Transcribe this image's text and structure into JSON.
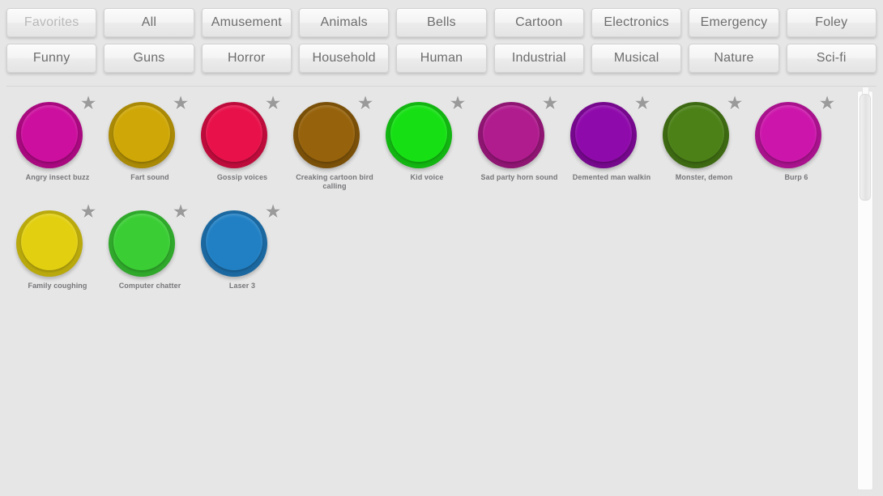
{
  "tabs": {
    "row1": [
      {
        "label": "Favorites",
        "disabled": true
      },
      {
        "label": "All",
        "disabled": false
      },
      {
        "label": "Amusement",
        "disabled": false
      },
      {
        "label": "Animals",
        "disabled": false
      },
      {
        "label": "Bells",
        "disabled": false
      },
      {
        "label": "Cartoon",
        "disabled": false
      },
      {
        "label": "Electronics",
        "disabled": false
      },
      {
        "label": "Emergency",
        "disabled": false
      },
      {
        "label": "Foley",
        "disabled": false
      }
    ],
    "row2": [
      {
        "label": "Funny",
        "disabled": false
      },
      {
        "label": "Guns",
        "disabled": false
      },
      {
        "label": "Horror",
        "disabled": false
      },
      {
        "label": "Household",
        "disabled": false
      },
      {
        "label": "Human",
        "disabled": false
      },
      {
        "label": "Industrial",
        "disabled": false
      },
      {
        "label": "Musical",
        "disabled": false
      },
      {
        "label": "Nature",
        "disabled": false
      },
      {
        "label": "Sci-fi",
        "disabled": false
      }
    ]
  },
  "pads": [
    {
      "label": "Angry insect buzz",
      "color": "#cc0f9e",
      "rim": "#a8097f",
      "favorite_icon": "star-icon"
    },
    {
      "label": "Fart sound",
      "color": "#cfa706",
      "rim": "#a98905",
      "favorite_icon": "star-icon"
    },
    {
      "label": "Gossip voices",
      "color": "#e8114a",
      "rim": "#bd0c3c",
      "favorite_icon": "star-icon"
    },
    {
      "label": "Creaking cartoon bird calling",
      "color": "#96620b",
      "rim": "#7a5009",
      "favorite_icon": "star-icon"
    },
    {
      "label": "Kid voice",
      "color": "#16e014",
      "rim": "#12b511",
      "favorite_icon": "star-icon"
    },
    {
      "label": "Sad party horn sound",
      "color": "#b01b8e",
      "rim": "#8f1573",
      "favorite_icon": "star-icon"
    },
    {
      "label": "Demented man walkin",
      "color": "#8f0aab",
      "rim": "#75088c",
      "favorite_icon": "star-icon"
    },
    {
      "label": "Monster, demon",
      "color": "#4b8117",
      "rim": "#3d6912",
      "favorite_icon": "star-icon"
    },
    {
      "label": "Burp 6",
      "color": "#cc16ab",
      "rim": "#a8128c",
      "favorite_icon": "star-icon"
    },
    {
      "label": "Family coughing",
      "color": "#e2cf10",
      "rim": "#b9a90d",
      "favorite_icon": "star-icon"
    },
    {
      "label": "Computer chatter",
      "color": "#3ace34",
      "rim": "#2fa82b",
      "favorite_icon": "star-icon"
    },
    {
      "label": "Laser 3",
      "color": "#2180c4",
      "rim": "#1b68a0",
      "favorite_icon": "star-icon"
    }
  ],
  "scrollbar": {
    "name": "vertical-scrollbar",
    "thumb_name": "scrollbar-thumb"
  },
  "icons": {
    "star": "★"
  },
  "colors": {
    "background": "#e6e6e6",
    "tab_text": "#6d6d6d",
    "tab_text_disabled": "#b9b9b9",
    "label_text": "#77767a",
    "star": "#9a9a9a"
  },
  "watermark": ""
}
